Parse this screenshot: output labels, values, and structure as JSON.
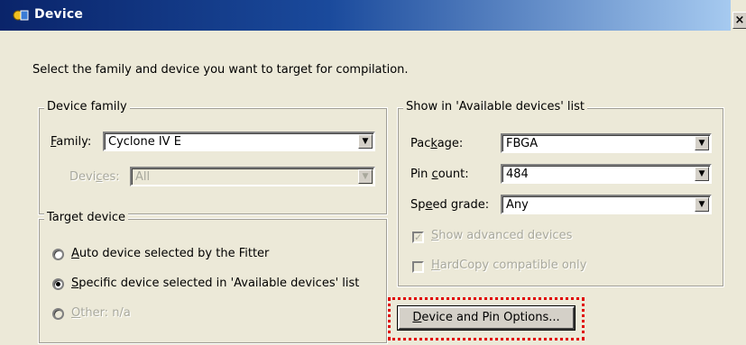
{
  "window": {
    "title": "Device",
    "close_glyph": "×",
    "icon": "device-app-icon"
  },
  "intro_text": "Select the family and device you want to target for compilation.",
  "device_family": {
    "group_label": "Device family",
    "family_label_prefix": "",
    "family_label_mnemonic": "F",
    "family_label_rest": "amily:",
    "family_value": "Cyclone IV E",
    "devices_label_prefix": "Devi",
    "devices_label_mnemonic": "c",
    "devices_label_rest": "es:",
    "devices_value": "All"
  },
  "target_device": {
    "group_label": "Target device",
    "options": [
      {
        "mnemonic": "A",
        "rest": "uto device selected by the Fitter",
        "checked": false,
        "disabled": false
      },
      {
        "mnemonic": "S",
        "rest": "pecific device selected in 'Available devices' list",
        "checked": true,
        "disabled": false
      },
      {
        "mnemonic": "O",
        "rest": "ther:  n/a",
        "checked": false,
        "disabled": true
      }
    ]
  },
  "show_in_list": {
    "group_label": "Show in 'Available devices' list",
    "package_label_prefix": "Pac",
    "package_label_mnemonic": "k",
    "package_label_rest": "age:",
    "package_value": "FBGA",
    "pin_label_prefix": "Pin ",
    "pin_label_mnemonic": "c",
    "pin_label_rest": "ount:",
    "pin_value": "484",
    "speed_label_prefix": "Sp",
    "speed_label_mnemonic": "e",
    "speed_label_rest": "ed grade:",
    "speed_value": "Any",
    "show_advanced_prefix": "",
    "show_advanced_mnemonic": "S",
    "show_advanced_rest": "how advanced devices",
    "show_advanced_checked": true,
    "hardcopy_prefix": "",
    "hardcopy_mnemonic": "H",
    "hardcopy_rest": "ardCopy compatible only",
    "hardcopy_checked": false
  },
  "device_pin_button": {
    "mnemonic": "D",
    "rest": "evice and Pin Options..."
  },
  "colors": {
    "dialog_bg": "#ece9d8",
    "title_gradient_start": "#0a246a",
    "highlight_border": "#e00000"
  }
}
